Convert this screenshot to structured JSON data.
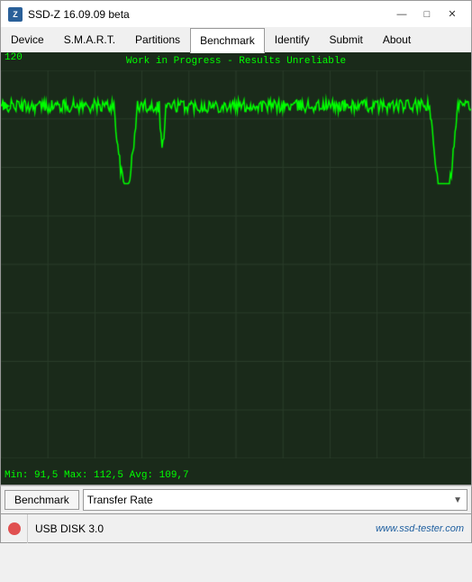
{
  "titleBar": {
    "icon": "Z",
    "title": "SSD-Z 16.09.09 beta",
    "minimize": "—",
    "maximize": "□",
    "close": "✕"
  },
  "tabs": [
    {
      "label": "Device",
      "active": false
    },
    {
      "label": "S.M.A.R.T.",
      "active": false
    },
    {
      "label": "Partitions",
      "active": false
    },
    {
      "label": "Benchmark",
      "active": true
    },
    {
      "label": "Identify",
      "active": false
    },
    {
      "label": "Submit",
      "active": false
    },
    {
      "label": "About",
      "active": false
    }
  ],
  "chart": {
    "header": "Work in Progress - Results Unreliable",
    "yTop": "120",
    "yBottom": "0",
    "footer": "Min: 91,5  Max: 112,5  Avg: 109,7"
  },
  "benchmarkBar": {
    "buttonLabel": "Benchmark",
    "selectValue": "Transfer Rate"
  },
  "statusBar": {
    "diskLabel": "USB DISK 3.0",
    "website": "www.ssd-tester.com"
  }
}
